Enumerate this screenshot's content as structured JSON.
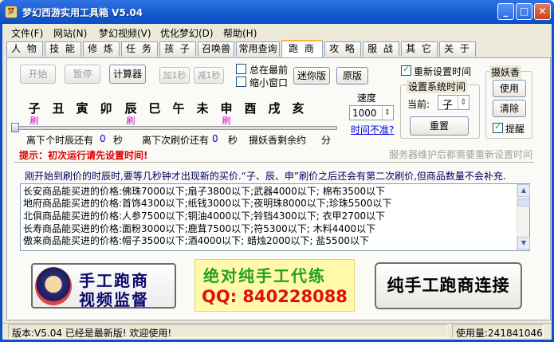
{
  "window": {
    "title": "梦幻西游实用工具箱 V5.04",
    "app_icon": "梦"
  },
  "menu": [
    "文件(F)",
    "网站(N)",
    "梦幻视频(V)",
    "优化梦幻(D)",
    "帮助(H)"
  ],
  "tabs": [
    "人 物",
    "技 能",
    "修 炼",
    "任 务",
    "孩 子",
    "召唤兽",
    "常用查询",
    "跑 商",
    "攻 略",
    "服 战",
    "其 它",
    "关 于"
  ],
  "active_tab": "跑 商",
  "controls": {
    "start": "开始",
    "pause": "暂停",
    "calculator": "计算器",
    "add_second": "加1秒",
    "sub_second": "减1秒",
    "always_top": "总在最前",
    "mini_window": "缩小窗口",
    "mini_version": "迷你版",
    "original_version": "原版"
  },
  "hours": [
    "子",
    "丑",
    "寅",
    "卯",
    "辰",
    "巳",
    "午",
    "未",
    "申",
    "酉",
    "戌",
    "亥"
  ],
  "hour_tags": {
    "子": "刷",
    "辰": "刷",
    "申": "刷"
  },
  "speed": {
    "label": "速度",
    "value": "1000",
    "not_accurate": "时间不准?"
  },
  "time_settings": {
    "reset_label": "重新设置时间",
    "group_label": "设置系统时间",
    "current_label": "当前:",
    "current_value": "子",
    "reset_button": "重置"
  },
  "incense": {
    "group_label": "摄妖香",
    "use": "使用",
    "clear": "清除",
    "remind": "提醒"
  },
  "timers": {
    "next_hour_label": "离下个时辰还有",
    "next_hour_value": "0",
    "next_hour_unit": "秒",
    "next_refresh_label": "离下次刷价还有",
    "next_refresh_value": "0",
    "next_refresh_unit": "秒",
    "incense_label": "摄妖香剩余约",
    "incense_unit": "分"
  },
  "hint": "提示：初次运行请先设置时间!",
  "server_note": "服务器维护后都需要重新设置时间",
  "notice": "刚开始到刷价的时辰时,要等几秒钟才出现新的买价.“子、辰、申”刷价之后还会有第二次刷价,但商品数量不会补充.",
  "price_lines": [
    "长安商品能买进的价格:佛珠7000以下;扇子3800以下;武器4000以下;    棉布3500以下",
    "地府商品能买进的价格:首饰4300以下;纸钱3000以下;夜明珠8000以下;珍珠5500以下",
    "北俱商品能买进的价格:人参7500以下;铜油4000以下;铃铛4300以下;    衣甲2700以下",
    "长寿商品能买进的价格:面粉3000以下;鹿茸7500以下;符5300以下;    木料4400以下",
    "傲来商品能买进的价格:帽子3500以下;酒4000以下;    蜡烛2000以下;    盐5500以下"
  ],
  "banner1": {
    "line1": "手工跑商",
    "line2": "视频监督"
  },
  "banner2": {
    "line1": "绝对纯手工代练",
    "line2": "QQ: 840228088"
  },
  "banner3": "纯手工跑商连接",
  "status": {
    "version": "版本:V5.04 已经是最新版! 欢迎使用!",
    "usage": "使用量:241841046"
  }
}
